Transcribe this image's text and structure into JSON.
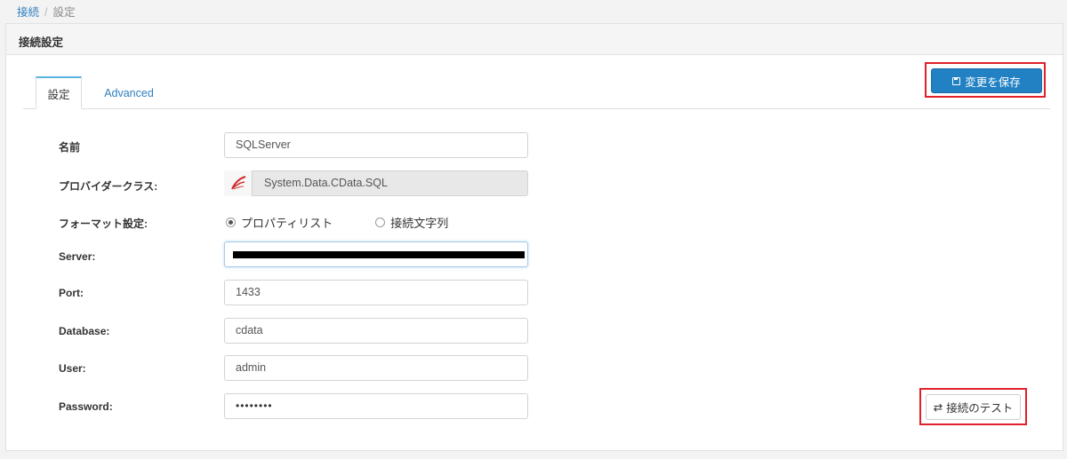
{
  "breadcrumb": {
    "parent": "接続",
    "separator": "/",
    "current": "設定"
  },
  "panel": {
    "title": "接続設定"
  },
  "toolbar": {
    "save_label": "変更を保存",
    "save_icon": "floppy-disk-icon"
  },
  "tabs": [
    {
      "label": "設定",
      "active": true
    },
    {
      "label": "Advanced",
      "active": false
    }
  ],
  "form": {
    "name": {
      "label": "名前",
      "value": "SQLServer"
    },
    "provider": {
      "label": "プロバイダークラス:",
      "value": "System.Data.CData.SQL",
      "icon": "cdata-logo-icon"
    },
    "format": {
      "label": "フォーマット設定:",
      "options": [
        {
          "label": "プロパティリスト",
          "checked": true
        },
        {
          "label": "接続文字列",
          "checked": false
        }
      ]
    },
    "server": {
      "label": "Server:",
      "value": ""
    },
    "port": {
      "label": "Port:",
      "value": "1433"
    },
    "database": {
      "label": "Database:",
      "value": "cdata"
    },
    "user": {
      "label": "User:",
      "value": "admin"
    },
    "password": {
      "label": "Password:",
      "value": "••••••••"
    }
  },
  "test_button": {
    "label": "接続のテスト",
    "icon": "swap-arrows-icon"
  },
  "colors": {
    "primary": "#2181c3",
    "link": "#2f7fbf",
    "highlight": "#e0202a",
    "tab_accent": "#5bb3e3"
  }
}
